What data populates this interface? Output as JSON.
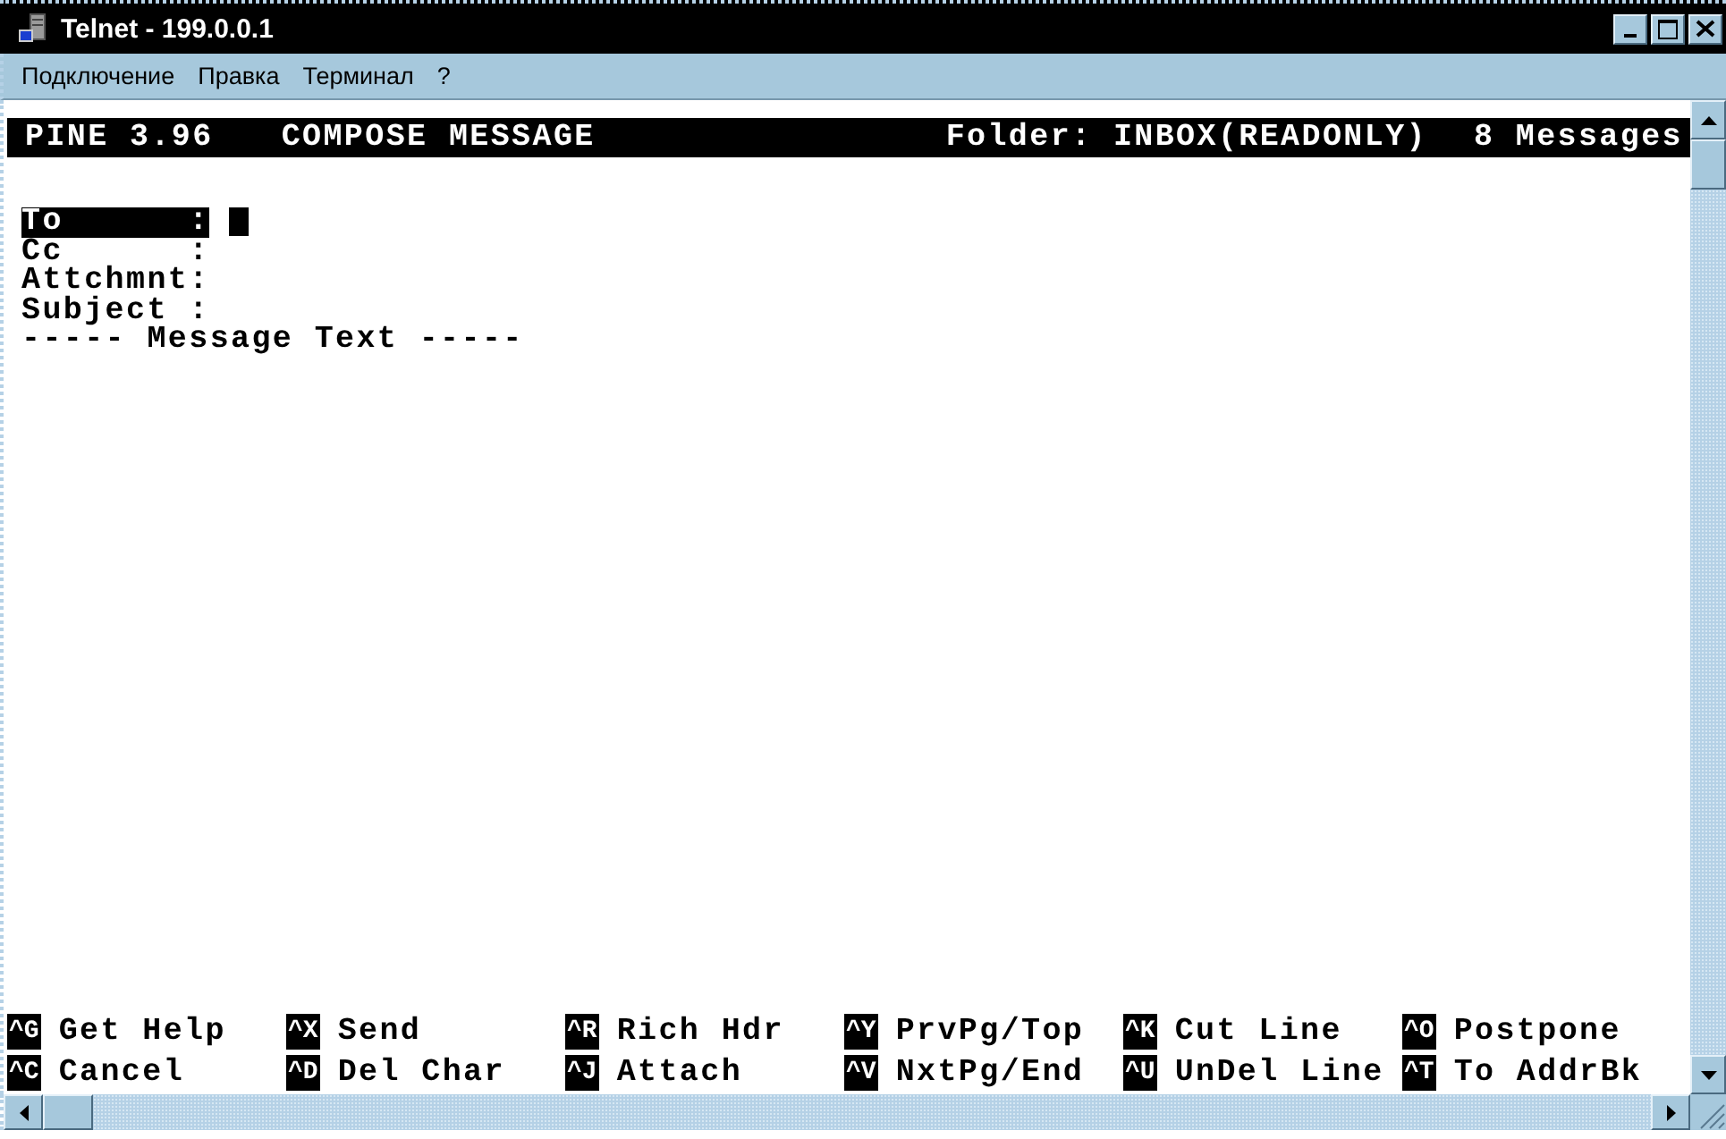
{
  "window": {
    "title": "Telnet - 199.0.0.1"
  },
  "menu": [
    {
      "label": "Подключение"
    },
    {
      "label": "Правка"
    },
    {
      "label": "Терминал"
    },
    {
      "label": "?"
    }
  ],
  "terminal": {
    "header": {
      "app": "PINE 3.96",
      "screen": "COMPOSE MESSAGE",
      "folder": "Folder: INBOX(READONLY)",
      "count": "8 Messages"
    },
    "fields": [
      {
        "label": "To      :",
        "selected": true
      },
      {
        "label": "Cc      :",
        "selected": false
      },
      {
        "label": "Attchmnt:",
        "selected": false
      },
      {
        "label": "Subject :",
        "selected": false
      }
    ],
    "separator": "----- Message Text -----",
    "commands": [
      {
        "key": "^G",
        "label": "Get Help"
      },
      {
        "key": "^X",
        "label": "Send"
      },
      {
        "key": "^R",
        "label": "Rich Hdr"
      },
      {
        "key": "^Y",
        "label": "PrvPg/Top"
      },
      {
        "key": "^K",
        "label": "Cut Line"
      },
      {
        "key": "^O",
        "label": "Postpone"
      },
      {
        "key": "^C",
        "label": "Cancel"
      },
      {
        "key": "^D",
        "label": "Del Char"
      },
      {
        "key": "^J",
        "label": "Attach"
      },
      {
        "key": "^V",
        "label": "NxtPg/End"
      },
      {
        "key": "^U",
        "label": "UnDel Line"
      },
      {
        "key": "^T",
        "label": "To AddrBk"
      }
    ]
  }
}
